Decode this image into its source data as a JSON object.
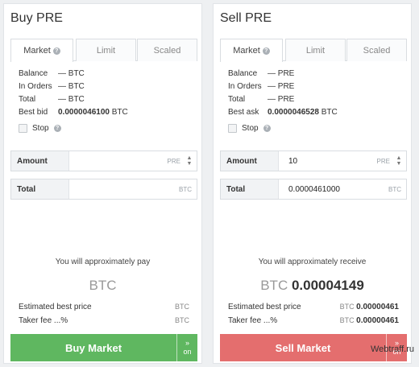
{
  "buy": {
    "title": "Buy PRE",
    "tabs": [
      "Market",
      "Limit",
      "Scaled"
    ],
    "info": [
      {
        "label": "Balance",
        "value": "— BTC"
      },
      {
        "label": "In Orders",
        "value": "— BTC"
      },
      {
        "label": "Total",
        "value": "— BTC"
      }
    ],
    "best_label": "Best bid",
    "best_value": "0.0000046100",
    "best_cur": "BTC",
    "stop_label": "Stop",
    "amount_label": "Amount",
    "amount_value": "",
    "amount_cur": "PRE",
    "total_label": "Total",
    "total_value": "",
    "total_cur": "BTC",
    "approx_text": "You will approximately pay",
    "big_cur": "BTC",
    "big_value": "",
    "est_price_label": "Estimated best price",
    "est_price_cur": "BTC",
    "est_price_value": "",
    "taker_label": "Taker fee ...%",
    "taker_cur": "BTC",
    "taker_value": "",
    "button_label": "Buy  Market",
    "side_label": "on",
    "color": "#5fb760"
  },
  "sell": {
    "title": "Sell PRE",
    "tabs": [
      "Market",
      "Limit",
      "Scaled"
    ],
    "info": [
      {
        "label": "Balance",
        "value": "— PRE"
      },
      {
        "label": "In Orders",
        "value": "— PRE"
      },
      {
        "label": "Total",
        "value": "— PRE"
      }
    ],
    "best_label": "Best ask",
    "best_value": "0.0000046528",
    "best_cur": "BTC",
    "stop_label": "Stop",
    "amount_label": "Amount",
    "amount_value": "10",
    "amount_cur": "PRE",
    "total_label": "Total",
    "total_value": "0.0000461000",
    "total_cur": "BTC",
    "approx_text": "You will approximately receive",
    "big_cur": "BTC",
    "big_value": "0.00004149",
    "est_price_label": "Estimated best price",
    "est_price_cur": "BTC",
    "est_price_value": "0.00000461",
    "taker_label": "Taker fee ...%",
    "taker_cur": "BTC",
    "taker_value": "0.00000461",
    "button_label": "Sell  Market",
    "side_label": "on",
    "color": "#e46e6e"
  },
  "watermark": "Webtraff.ru"
}
